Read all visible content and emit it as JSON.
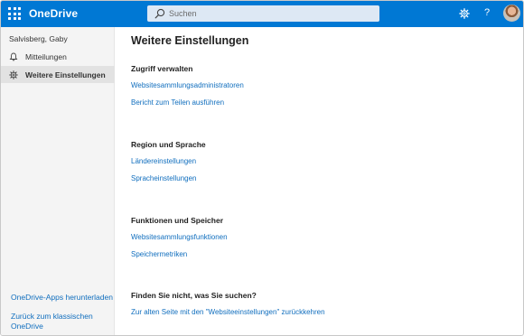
{
  "app": {
    "brand": "OneDrive"
  },
  "search": {
    "placeholder": "Suchen"
  },
  "header": {
    "help_label": "?"
  },
  "sidebar": {
    "user": "Salvisberg, Gaby",
    "items": [
      {
        "label": "Mitteilungen",
        "icon": "bell-icon"
      },
      {
        "label": "Weitere Einstellungen",
        "icon": "gear-icon",
        "active": true
      }
    ],
    "bottom_links": [
      {
        "label": "OneDrive-Apps herunterladen"
      },
      {
        "label": "Zurück zum klassischen OneDrive"
      }
    ]
  },
  "main": {
    "title": "Weitere Einstellungen",
    "sections": [
      {
        "title": "Zugriff verwalten",
        "links": [
          "Websitesammlungsadministratoren",
          "Bericht zum Teilen ausführen"
        ]
      },
      {
        "title": "Region und Sprache",
        "links": [
          "Ländereinstellungen",
          "Spracheinstellungen"
        ]
      },
      {
        "title": "Funktionen und Speicher",
        "links": [
          "Websitesammlungsfunktionen",
          "Speichermetriken"
        ]
      },
      {
        "title": "Finden Sie nicht, was Sie suchen?",
        "links": [
          "Zur alten Seite mit den \"Websiteeinstellungen\" zurückkehren"
        ]
      }
    ]
  },
  "colors": {
    "accent": "#0078d4",
    "link": "#106ebe",
    "sidebar_bg": "#f4f4f4"
  }
}
